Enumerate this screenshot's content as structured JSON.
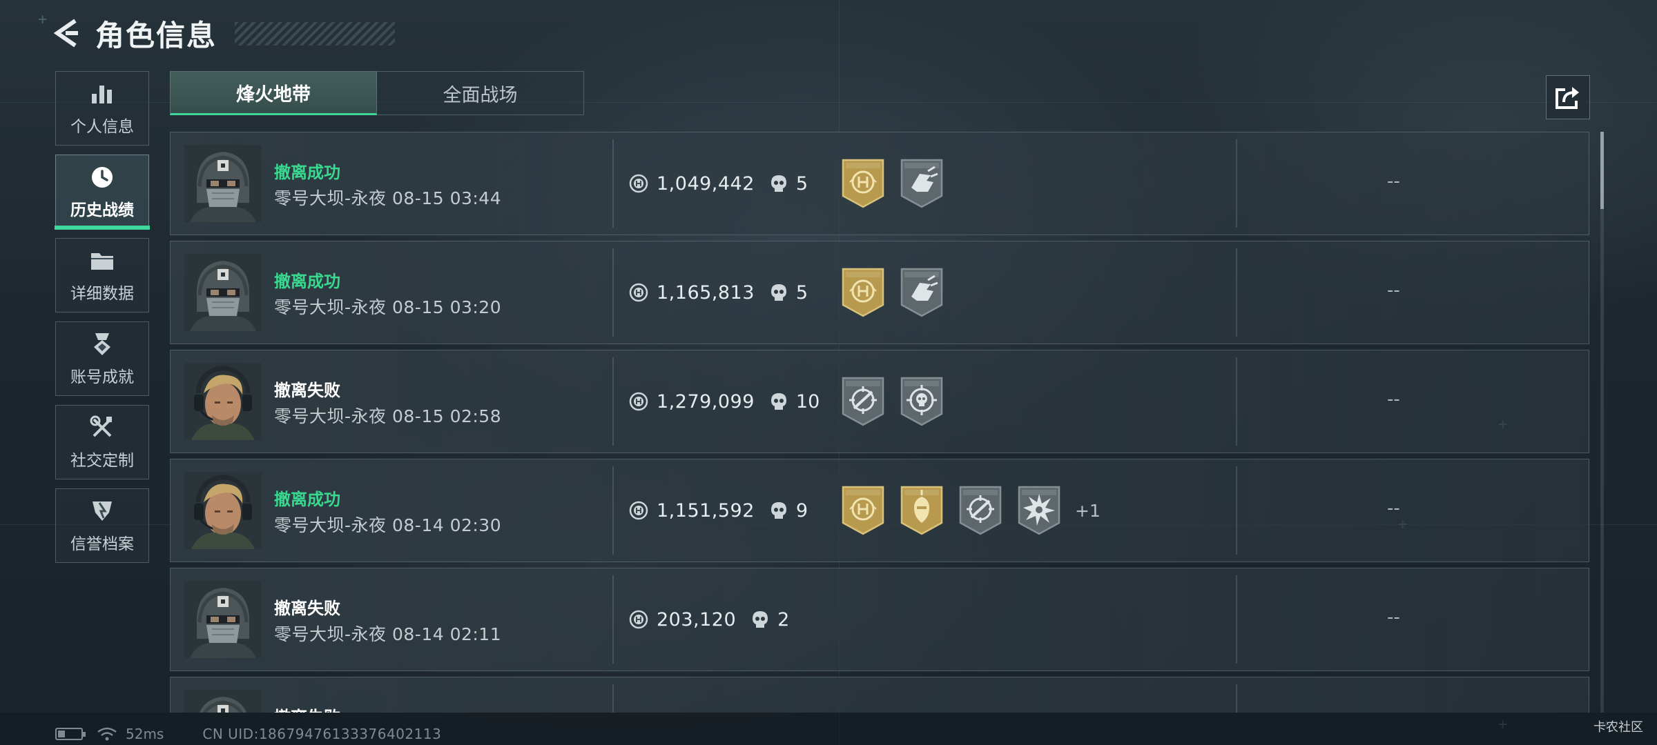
{
  "header": {
    "title": "角色信息"
  },
  "sidebar": {
    "items": [
      {
        "label": "个人信息",
        "icon": "bar-chart-icon",
        "active": false
      },
      {
        "label": "历史战绩",
        "icon": "clock-icon",
        "active": true
      },
      {
        "label": "详细数据",
        "icon": "folder-icon",
        "active": false
      },
      {
        "label": "账号成就",
        "icon": "medal-icon",
        "active": false
      },
      {
        "label": "社交定制",
        "icon": "wrench-screwdriver-icon",
        "active": false
      },
      {
        "label": "信誉档案",
        "icon": "shield-badge-icon",
        "active": false
      }
    ]
  },
  "tabs": [
    {
      "label": "烽火地带",
      "active": true
    },
    {
      "label": "全面战场",
      "active": false
    }
  ],
  "records": [
    {
      "outcome": "撤离成功",
      "success": true,
      "map": "零号大坝-永夜",
      "time": "08-15 03:44",
      "value": "1,049,442",
      "kills": "5",
      "badges": [
        "gold-emblem-icon",
        "grey-hand-icon"
      ],
      "extra": "",
      "dash": "--",
      "avatar": "helmet-operator"
    },
    {
      "outcome": "撤离成功",
      "success": true,
      "map": "零号大坝-永夜",
      "time": "08-15 03:20",
      "value": "1,165,813",
      "kills": "5",
      "badges": [
        "gold-emblem-icon",
        "grey-hand-icon"
      ],
      "extra": "",
      "dash": "--",
      "avatar": "helmet-operator"
    },
    {
      "outcome": "撤离失败",
      "success": false,
      "map": "零号大坝-永夜",
      "time": "08-15 02:58",
      "value": "1,279,099",
      "kills": "10",
      "badges": [
        "grey-crosshair-rifle-icon",
        "grey-crosshair-skull-icon"
      ],
      "extra": "",
      "dash": "--",
      "avatar": "blond-operator"
    },
    {
      "outcome": "撤离成功",
      "success": true,
      "map": "零号大坝-永夜",
      "time": "08-14 02:30",
      "value": "1,151,592",
      "kills": "9",
      "badges": [
        "gold-emblem-icon",
        "gold-soldier-icon",
        "grey-crosshair-rifle-icon",
        "grey-burst-icon"
      ],
      "extra": "+1",
      "dash": "--",
      "avatar": "blond-operator"
    },
    {
      "outcome": "撤离失败",
      "success": false,
      "map": "零号大坝-永夜",
      "time": "08-14 02:11",
      "value": "203,120",
      "kills": "2",
      "badges": [],
      "extra": "",
      "dash": "--",
      "avatar": "helmet-operator"
    },
    {
      "outcome": "撤离失败",
      "success": false,
      "map": "",
      "time": "",
      "value": "",
      "kills": "",
      "badges": [],
      "extra": "",
      "dash": "",
      "avatar": "helmet-operator"
    }
  ],
  "footer": {
    "ping": "52ms",
    "uid": "CN UID:18679476133376402113",
    "watermark": "卡农社区"
  },
  "colors": {
    "success": "#38d98f",
    "accent": "#3fd89a",
    "gold": "#b89a4e"
  }
}
